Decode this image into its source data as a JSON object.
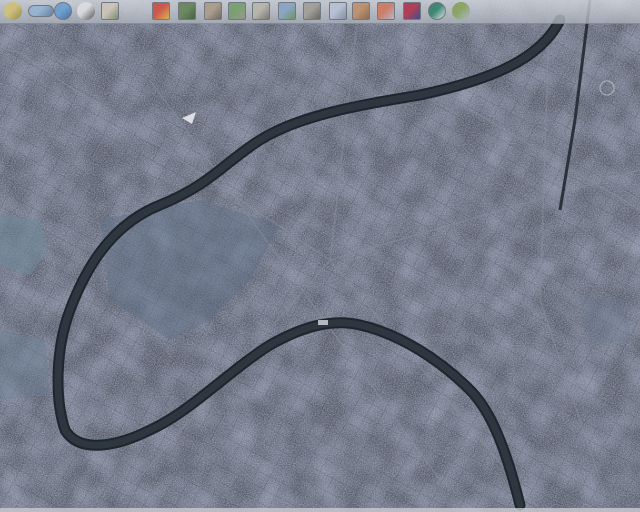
{
  "map": {
    "view": "satellite",
    "base_color": "#4f5563",
    "river_color": "#2b323b",
    "water_edge_color": "#1f252c"
  },
  "toolbar": {
    "tools": [
      {
        "name": "home-icon",
        "colors": [
          "#e6d37a",
          "#9c8a3a"
        ]
      },
      {
        "name": "world-map-icon",
        "colors": [
          "#9fc3e6",
          "#5f7fa0"
        ]
      },
      {
        "name": "globe-icon",
        "colors": [
          "#6fa8e0",
          "#3a6fa8"
        ]
      },
      {
        "name": "zoom-icon",
        "colors": [
          "#f2f2f2",
          "#444444"
        ]
      },
      {
        "name": "layer-terrain-icon",
        "colors": [
          "#e0d6c4",
          "#7d8f6a"
        ]
      },
      {
        "name": "layer-heatmap-icon",
        "colors": [
          "#e04a3a",
          "#f0c23a"
        ]
      },
      {
        "name": "layer-landcover-icon",
        "colors": [
          "#6a8f55",
          "#3f5a38"
        ]
      },
      {
        "name": "layer-elevation-icon",
        "colors": [
          "#b7a68d",
          "#6d6050"
        ]
      },
      {
        "name": "layer-vegetation-icon",
        "colors": [
          "#7aa86a",
          "#a0a08a"
        ]
      },
      {
        "name": "layer-roads-icon",
        "colors": [
          "#c9c4b5",
          "#7f7a6c"
        ]
      },
      {
        "name": "layer-hydro-icon",
        "colors": [
          "#8fb0d0",
          "#6f9a5a"
        ]
      },
      {
        "name": "layer-city-icon",
        "colors": [
          "#b0aba0",
          "#5e5a52"
        ]
      },
      {
        "name": "layer-grid-icon",
        "colors": [
          "#c8d4e6",
          "#8795ac"
        ]
      },
      {
        "name": "layer-geology-icon",
        "colors": [
          "#d49a6a",
          "#8a6a4a"
        ]
      },
      {
        "name": "layer-boundaries-icon",
        "colors": [
          "#e07a5a",
          "#c8c8d8"
        ]
      },
      {
        "name": "flag-icon",
        "colors": [
          "#c0304a",
          "#2c3e8c"
        ]
      },
      {
        "name": "compass-icon",
        "colors": [
          "#2f8a6a",
          "#ffffff"
        ]
      },
      {
        "name": "landscape-icon",
        "colors": [
          "#8fae5a",
          "#b8c4d8"
        ]
      }
    ]
  }
}
